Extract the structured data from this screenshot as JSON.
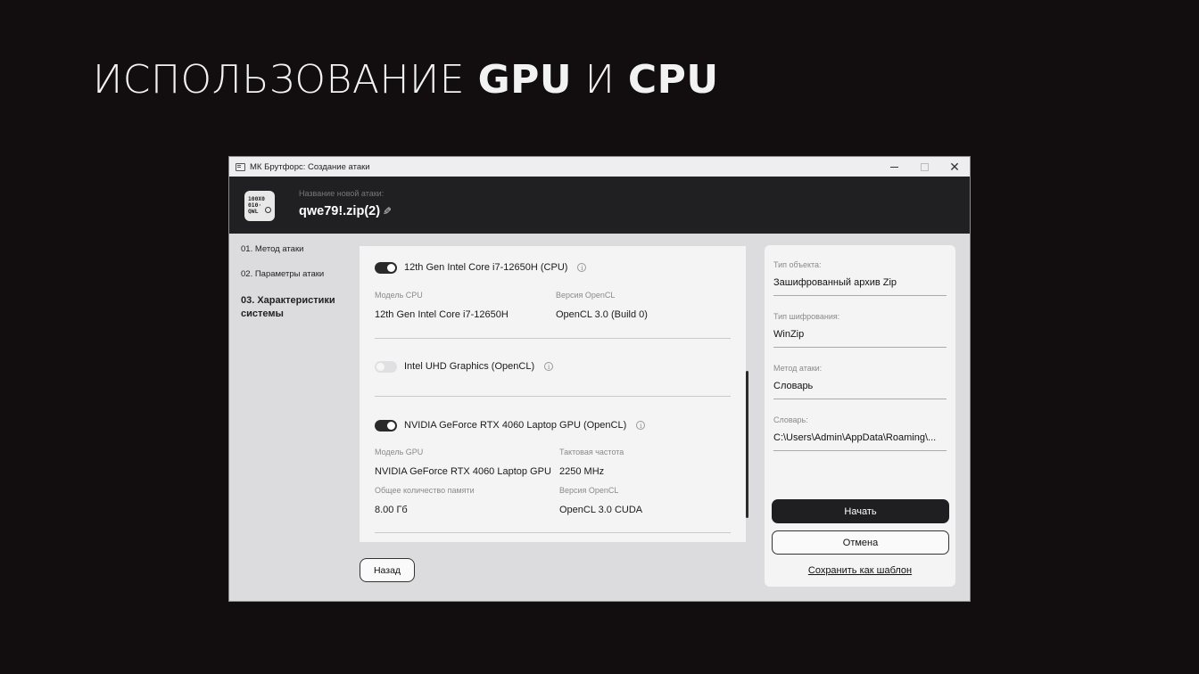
{
  "slide": {
    "title_prefix": "ИСПОЛЬЗОВАНИЕ ",
    "title_gpu": "GPU",
    "title_mid": " И ",
    "title_cpu": "CPU"
  },
  "window": {
    "title": "МК Брутфорс: Создание атаки",
    "close_glyph": "✕"
  },
  "header": {
    "logo_lines": [
      "100X0",
      "010·",
      "QWL"
    ],
    "label": "Название новой атаки:",
    "attack_name": "qwe79!.zip(2)",
    "edit_glyph": "✎"
  },
  "steps": [
    {
      "label": "01. Метод атаки"
    },
    {
      "label": "02. Параметры атаки"
    },
    {
      "label": "03. Характеристики системы"
    }
  ],
  "devices": {
    "cpu": {
      "name": "12th Gen Intel Core i7-12650H (CPU)",
      "enabled": true,
      "props": [
        {
          "label": "Модель CPU",
          "value": "12th Gen Intel Core i7-12650H"
        },
        {
          "label": "Версия OpenCL",
          "value": "OpenCL 3.0 (Build 0)"
        }
      ]
    },
    "igpu": {
      "name": "Intel UHD Graphics (OpenCL)",
      "enabled": false
    },
    "gpu": {
      "name": "NVIDIA GeForce RTX 4060 Laptop GPU (OpenCL)",
      "enabled": true,
      "props": [
        {
          "label": "Модель GPU",
          "value": "NVIDIA GeForce RTX 4060 Laptop GPU"
        },
        {
          "label": "Тактовая частота",
          "value": "2250 MHz"
        },
        {
          "label": "Общее количество памяти",
          "value": "8.00 Гб"
        },
        {
          "label": "Версия OpenCL",
          "value": "OpenCL 3.0 CUDA"
        }
      ]
    },
    "info_glyph": "i"
  },
  "buttons": {
    "back": "Назад",
    "start": "Начать",
    "cancel": "Отмена",
    "save_template": "Сохранить как шаблон"
  },
  "summary": [
    {
      "label": "Тип объекта:",
      "value": "Зашифрованный архив Zip"
    },
    {
      "label": "Тип шифрования:",
      "value": "WinZip"
    },
    {
      "label": "Метод атаки:",
      "value": "Словарь"
    },
    {
      "label": "Словарь:",
      "value": "C:\\Users\\Admin\\AppData\\Roaming\\..."
    }
  ]
}
